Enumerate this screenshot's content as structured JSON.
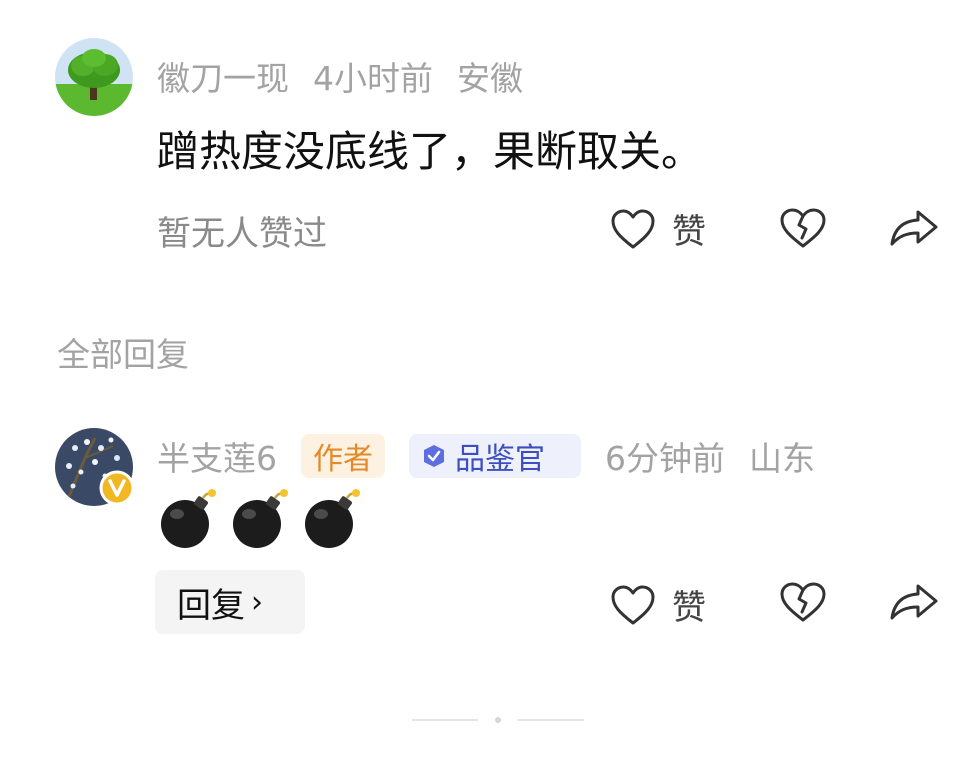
{
  "comment1": {
    "username": "徽刀一现",
    "time": "4小时前",
    "location": "安徽",
    "text": "蹭热度没底线了，果断取关。",
    "likes_status": "暂无人赞过",
    "like_label": "赞"
  },
  "section_title": "全部回复",
  "reply1": {
    "username": "半支莲6",
    "author_badge": "作者",
    "rank_badge": "品鉴官",
    "time": "6分钟前",
    "location": "山东",
    "like_label": "赞",
    "reply_button_label": "回复",
    "reply_chevron": "›"
  },
  "icons": {
    "avatar1": "tree-avatar",
    "avatar2": "blossom-avatar",
    "verified_badge": "v-badge-icon",
    "like": "heart-outline-icon",
    "dislike": "broken-heart-icon",
    "share": "share-arrow-icon",
    "emoji": "bomb-emoji"
  },
  "colors": {
    "meta_text": "#a3a3a3",
    "author_badge_bg": "#fdf1e1",
    "author_badge_fg": "#e38a2a",
    "rank_badge_bg": "#eef0fc",
    "rank_badge_fg": "#3d4ec0",
    "verified_badge": "#f2b824"
  }
}
